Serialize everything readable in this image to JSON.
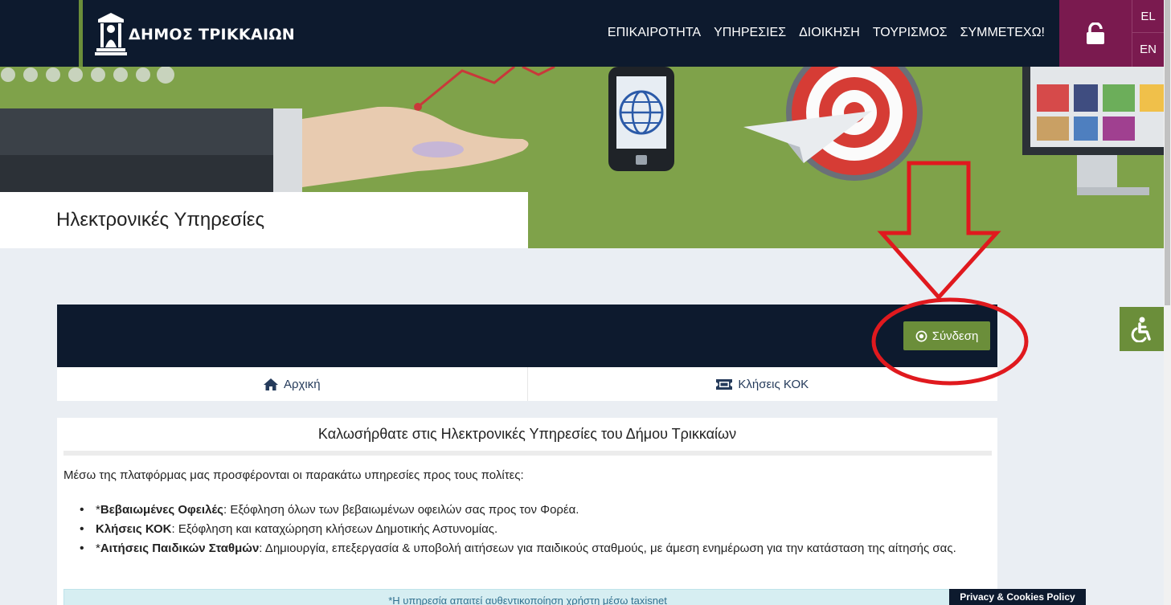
{
  "header": {
    "logo_text": "ΔΗΜΟΣ ΤΡΙΚΚΑΙΩΝ",
    "nav": [
      "ΕΠΙΚΑΙΡΟΤΗΤΑ",
      "ΥΠΗΡΕΣΙΕΣ",
      "ΔΙΟΙΚΗΣΗ",
      "ΤΟΥΡΙΣΜΟΣ",
      "ΣΥΜΜΕΤΕΧΩ!"
    ],
    "lock_icon": "unlock-icon",
    "languages": [
      "EL",
      "EN"
    ]
  },
  "hero": {
    "title": "Ηλεκτρονικές Υπηρεσίες",
    "illustration": "hand-phone-target-monitor-illustration"
  },
  "panel": {
    "login_label": "Σύνδεση",
    "login_icon": "dot-circle-icon",
    "tabs": [
      {
        "label": "Αρχική",
        "icon": "home-icon"
      },
      {
        "label": "Κλήσεις ΚΟΚ",
        "icon": "ticket-icon"
      }
    ]
  },
  "content": {
    "welcome": "Καλωσήρθατε στις Ηλεκτρονικές Υπηρεσίες του Δήμου Τρικκαίων",
    "intro": "Μέσω της πλατφόρμας μας προσφέρονται οι παρακάτω υπηρεσίες προς τους πολίτες:",
    "services": [
      {
        "prefix": "*",
        "title": "Βεβαιωμένες Οφειλές",
        "desc": ": Εξόφληση όλων των βεβαιωμένων οφειλών σας προς τον Φορέα."
      },
      {
        "prefix": "",
        "title": "Κλήσεις ΚΟΚ",
        "desc": ": Εξόφληση και καταχώρηση κλήσεων Δημοτικής Αστυνομίας."
      },
      {
        "prefix": "*",
        "title": "Αιτήσεις Παιδικών Σταθμών",
        "desc": ": Δημιουργία, επεξεργασία & υποβολή αιτήσεων για παιδικούς σταθμούς, με άμεση ενημέρωση για την κατάσταση της αίτησής σας."
      }
    ],
    "notice": "*Η υπηρεσία απαιτεί αυθεντικοποίηση χρήστη μέσω taxisnet"
  },
  "accessibility_icon": "wheelchair-icon",
  "cookie_label": "Privacy & Cookies Policy",
  "colors": {
    "navy": "#0d1a2e",
    "green": "#6b8e3a",
    "plum": "#7a1a4f",
    "annotation_red": "#e0191e"
  }
}
